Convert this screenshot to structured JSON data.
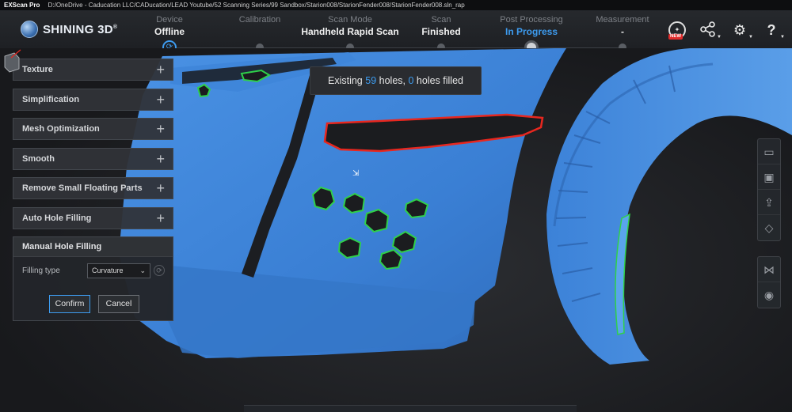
{
  "titlebar": {
    "app": "EXScan Pro",
    "path": "D:/OneDrive - Caducation LLC/CADucation/LEAD Youtube/52 Scanning Series/99 Sandbox/Starion008/StarionFender008/StarionFender008.sln_rap"
  },
  "brand": {
    "name": "SHINING 3D",
    "mark": "®"
  },
  "workflow": [
    {
      "label": "Device",
      "value": "Offline"
    },
    {
      "label": "Calibration",
      "value": ""
    },
    {
      "label": "Scan Mode",
      "value": "Handheld Rapid Scan"
    },
    {
      "label": "Scan",
      "value": "Finished"
    },
    {
      "label": "Post Processing",
      "value": "In Progress"
    },
    {
      "label": "Measurement",
      "value": "-"
    }
  ],
  "toolbar_icons": [
    "new-features-icon",
    "share-icon",
    "settings-icon",
    "help-icon"
  ],
  "toolbar_badge": "NEW",
  "message": {
    "prefix": "Existing",
    "existing": "59",
    "mid": "holes,",
    "filled": "0",
    "suffix": "holes filled"
  },
  "panel": {
    "sections": [
      "Texture",
      "Simplification",
      "Mesh Optimization",
      "Smooth",
      "Remove Small Floating Parts",
      "Auto Hole Filling"
    ],
    "manual": {
      "title": "Manual Hole Filling",
      "filling_type_label": "Filling type",
      "filling_type_value": "Curvature",
      "confirm": "Confirm",
      "cancel": "Cancel"
    }
  },
  "colors": {
    "accent": "#3d9cf0",
    "mesh": "#3a82d6",
    "hole_border": "#2fd04a",
    "selected_border": "#e8271f"
  }
}
